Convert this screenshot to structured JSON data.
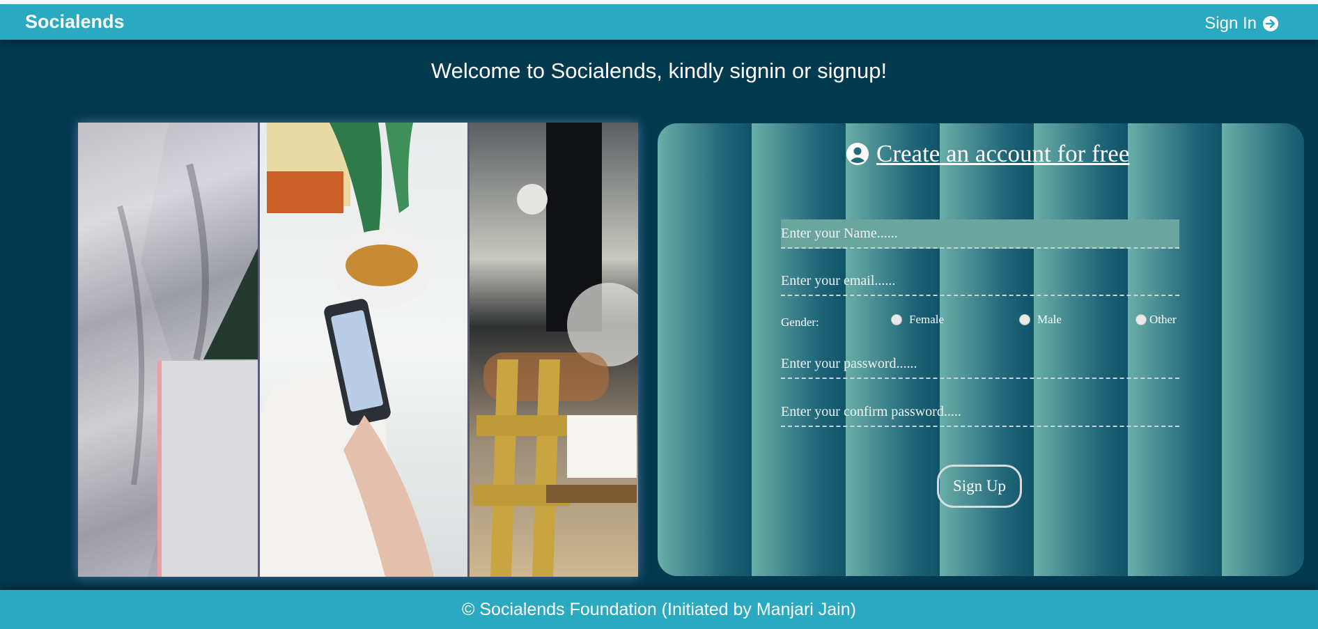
{
  "navbar": {
    "brand": "Socialends",
    "signin_label": "Sign In",
    "signin_icon": "arrow-circle-right-icon"
  },
  "welcome_text": "Welcome to Socialends, kindly signin or signup!",
  "signup_form": {
    "title_icon": "user-circle-icon",
    "title": " Create an account for free",
    "name_placeholder": "Enter your Name......",
    "email_placeholder": "Enter your email......",
    "gender_label": "Gender:",
    "gender_options": [
      "Female",
      "Male",
      "Other"
    ],
    "password_placeholder": "Enter your password......",
    "confirm_placeholder": "Enter your confirm password.....",
    "submit_label": "Sign Up"
  },
  "footer_text": "© Socialends Foundation (Initiated by Manjari Jain)",
  "colors": {
    "navbar": "#2aa9c0",
    "background": "#033a4f",
    "card_light": "#6aaea8",
    "card_dark": "#0f5368"
  }
}
